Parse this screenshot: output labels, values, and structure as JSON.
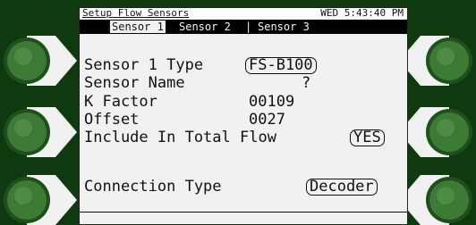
{
  "header": {
    "title": "Setup Flow Sensors",
    "clock": "WED 5:43:40 PM"
  },
  "tabs": [
    {
      "label": "Sensor 1",
      "active": true
    },
    {
      "label": "Sensor 2"
    },
    {
      "label": "Sensor 3"
    }
  ],
  "tab_separator": "|",
  "fields": {
    "sensor_type": {
      "label": "Sensor 1 Type",
      "value": "FS-B100"
    },
    "sensor_name": {
      "label": "Sensor Name",
      "value": "?"
    },
    "k_factor": {
      "label": "K Factor",
      "value": "00109"
    },
    "offset": {
      "label": "Offset",
      "value": "0027"
    },
    "include_total": {
      "label": "Include In Total Flow",
      "value": "YES"
    },
    "connection_type": {
      "label": "Connection Type",
      "value": "Decoder"
    }
  },
  "colors": {
    "bezel": "#0f3a10",
    "button": "#2f6b2a",
    "screen": "#f1f1f1",
    "tabbar": "#000000"
  },
  "icons": {
    "soft_button": "green-round-softkey-icon"
  }
}
